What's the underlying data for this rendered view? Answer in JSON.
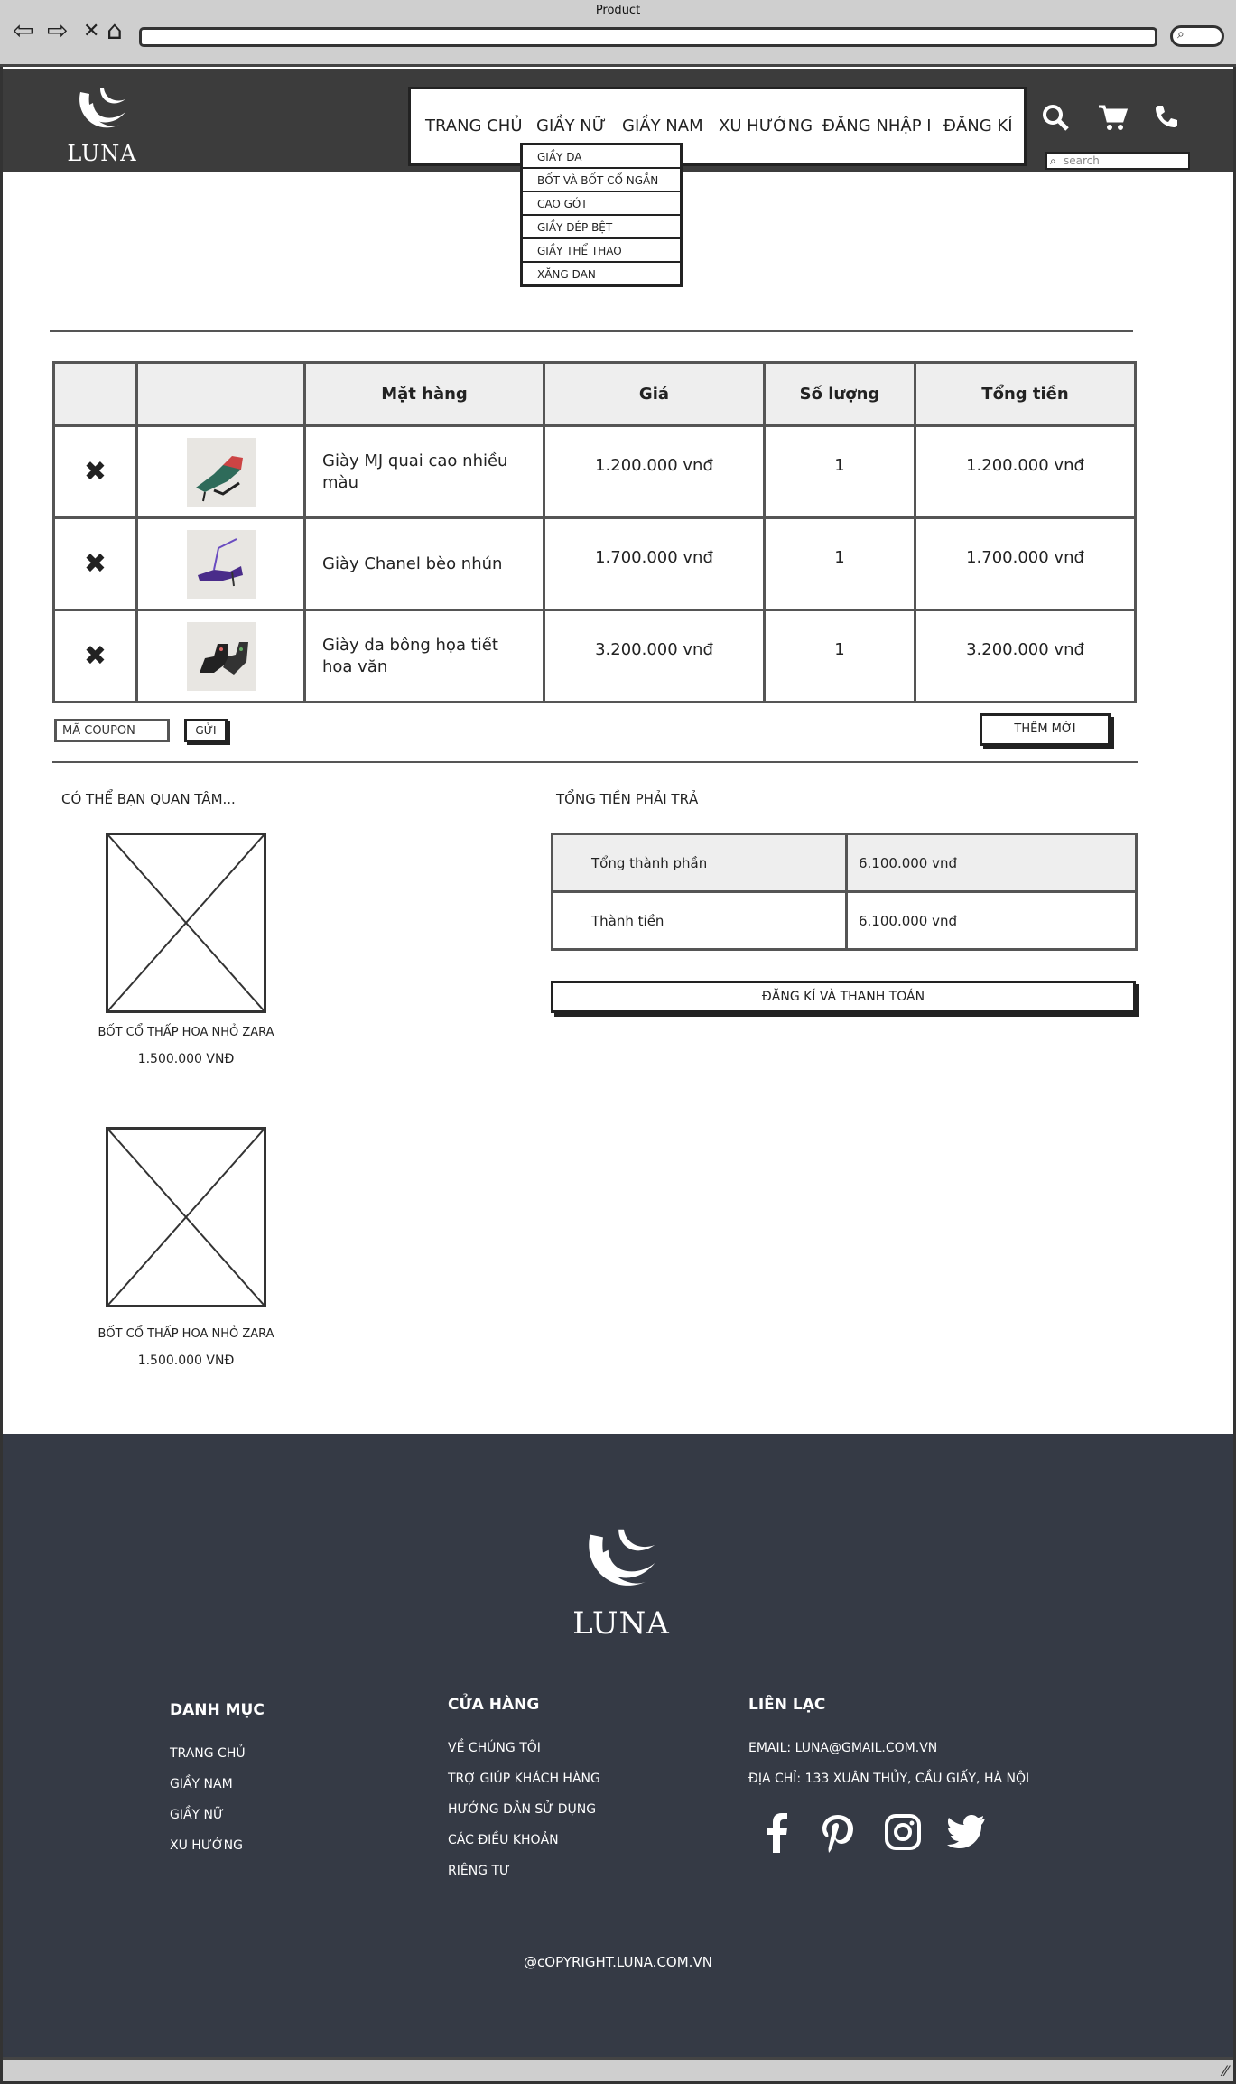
{
  "browser": {
    "title": "Product",
    "back_icon": "⇦",
    "forward_icon": "⇨",
    "close_icon": "✕",
    "home_icon": "⌂",
    "search_icon": "⌕"
  },
  "header": {
    "logo_text": "LUNA",
    "menu": [
      "TRANG CHỦ",
      "GIẦY NỮ",
      "GIẦY NAM",
      "XU HƯỚNG",
      "ĐĂNG NHẬP I",
      "ĐĂNG KÍ"
    ],
    "search_placeholder": "search",
    "icons": [
      "search-icon",
      "cart-icon",
      "phone-icon"
    ]
  },
  "dropdown": {
    "items": [
      "GIẦY DA",
      "BỐT VÀ BỐT CỔ NGẮN",
      "CAO GÓT",
      "GIẦY DÉP BỆT",
      "GIẦY THỂ THAO",
      "XĂNG ĐAN"
    ]
  },
  "cart": {
    "headers": [
      "",
      "",
      "Mặt hàng",
      "Giá",
      "Số lượng",
      "Tổng tiền"
    ],
    "rows": [
      {
        "name": "Giày MJ quai cao nhiều màu",
        "price": "1.200.000 vnđ",
        "qty": "1",
        "total": "1.200.000 vnđ"
      },
      {
        "name": "Giày Chanel bèo nhún",
        "price": "1.700.000 vnđ",
        "qty": "1",
        "total": "1.700.000 vnđ"
      },
      {
        "name": "Giày da bông họa tiết hoa văn",
        "price": "3.200.000 vnđ",
        "qty": "1",
        "total": "3.200.000 vnđ"
      }
    ],
    "coupon_placeholder": "MÃ COUPON",
    "send_label": "GỬI",
    "add_label": "THÊM MỚI"
  },
  "suggestions": {
    "title": "CÓ THỂ BẠN QUAN TÂM...",
    "items": [
      {
        "name": "BỐT CỔ THẤP HOA NHỎ ZARA",
        "price": "1.500.000 VNĐ"
      },
      {
        "name": "BỐT CỔ THẤP HOA NHỎ ZARA",
        "price": "1.500.000 VNĐ"
      }
    ]
  },
  "totals": {
    "title": "TỔNG TIỀN PHẢI TRẢ",
    "rows": [
      {
        "label": "Tổng thành phần",
        "value": "6.100.000 vnđ"
      },
      {
        "label": "Thành tiền",
        "value": "6.100.000 vnđ"
      }
    ],
    "checkout_label": "ĐĂNG KÍ VÀ THANH TOÁN"
  },
  "footer": {
    "logo_text": "LUNA",
    "col1_title": "DANH MỤC",
    "col1_links": [
      "TRANG CHỦ",
      "GIẦY NAM",
      "GIẦY NỮ",
      "XU HƯỚNG"
    ],
    "col2_title": "CỬA HÀNG",
    "col2_links": [
      "VỀ CHÚNG TÔI",
      "TRỢ GIÚP KHÁCH HÀNG",
      "HƯỚNG DẪN SỬ DỤNG",
      "CÁC ĐIỀU KHOẢN",
      "RIÊNG TƯ"
    ],
    "col3_title": "LIÊN LẠC",
    "email": "EMAIL: LUNA@GMAIL.COM.VN",
    "address": "ĐỊA CHỈ: 133 XUÂN THỦY, CẦU GIẤY, HÀ NỘI",
    "social": [
      "facebook-icon",
      "pinterest-icon",
      "instagram-icon",
      "twitter-icon"
    ],
    "copyright": "@cOPYRIGHT.LUNA.COM.VN"
  }
}
